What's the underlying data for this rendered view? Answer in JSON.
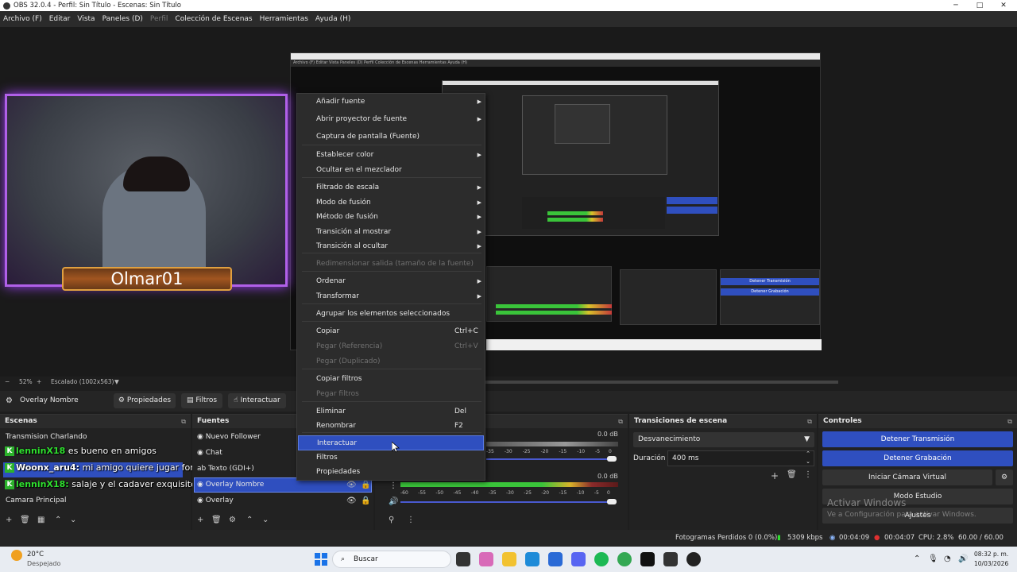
{
  "window": {
    "title": "OBS 32.0.4 - Perfil: Sin Título - Escenas: Sin Título",
    "minimize": "─",
    "maximize": "□",
    "close": "✕"
  },
  "menubar": [
    {
      "label": "Archivo (F)",
      "enabled": true
    },
    {
      "label": "Editar",
      "enabled": true
    },
    {
      "label": "Vista",
      "enabled": true
    },
    {
      "label": "Paneles (D)",
      "enabled": true
    },
    {
      "label": "Perfil",
      "enabled": false
    },
    {
      "label": "Colección de Escenas",
      "enabled": true
    },
    {
      "label": "Herramientas",
      "enabled": true
    },
    {
      "label": "Ayuda (H)",
      "enabled": true
    }
  ],
  "preview": {
    "camera_overlay_name": "Olmar01",
    "zoom": "52%",
    "scaling": "Escalado (1002x563)"
  },
  "context_menu": {
    "items": [
      {
        "label": "Añadir fuente",
        "submenu": true
      },
      {
        "label": "Abrir proyector de fuente",
        "submenu": true
      },
      {
        "label": "Captura de pantalla (Fuente)"
      },
      {
        "label": "Establecer color",
        "submenu": true
      },
      {
        "label": "Ocultar en el mezclador"
      },
      {
        "label": "Filtrado de escala",
        "submenu": true
      },
      {
        "label": "Modo de fusión",
        "submenu": true
      },
      {
        "label": "Método de fusión",
        "submenu": true
      },
      {
        "label": "Transición al mostrar",
        "submenu": true
      },
      {
        "label": "Transición al ocultar",
        "submenu": true
      },
      {
        "label": "Redimensionar salida (tamaño de la fuente)",
        "disabled": true
      },
      {
        "label": "Ordenar",
        "submenu": true
      },
      {
        "label": "Transformar",
        "submenu": true
      },
      {
        "label": "Agrupar los elementos seleccionados"
      },
      {
        "label": "Copiar",
        "shortcut": "Ctrl+C"
      },
      {
        "label": "Pegar (Referencia)",
        "shortcut": "Ctrl+V",
        "disabled": true
      },
      {
        "label": "Pegar (Duplicado)",
        "disabled": true
      },
      {
        "label": "Copiar filtros"
      },
      {
        "label": "Pegar filtros",
        "disabled": true
      },
      {
        "label": "Eliminar",
        "shortcut": "Del"
      },
      {
        "label": "Renombrar",
        "shortcut": "F2"
      },
      {
        "label": "Interactuar",
        "highlighted": true
      },
      {
        "label": "Filtros"
      },
      {
        "label": "Propiedades"
      }
    ]
  },
  "source_toolbar": {
    "selected_source": "Overlay Nombre",
    "properties": "Propiedades",
    "filters": "Filtros",
    "interact": "Interactuar"
  },
  "scenes": {
    "title": "Escenas",
    "items": [
      "Transmision Charlando",
      "Camara Principal"
    ],
    "chat": [
      {
        "user": "lenninX18",
        "msg": "es bueno en amigos"
      },
      {
        "user": "Woonx_aru4:",
        "msg": "mi amigo quiere jugar fornai"
      },
      {
        "user": "lenninX18:",
        "msg": "salaje y el cadaver exquisito tb es bueno"
      }
    ]
  },
  "sources": {
    "title": "Fuentes",
    "items": [
      "Nuevo Follower",
      "Chat",
      "Texto (GDI+)",
      "Overlay Nombre",
      "Overlay"
    ]
  },
  "mixer": {
    "db_top": "0.0 dB",
    "db_bottom": "0.0 dB",
    "ticks": [
      "-35",
      "-30",
      "-25",
      "-20",
      "-15",
      "-10",
      "-5",
      "0"
    ],
    "ticks_full": [
      "-60",
      "-55",
      "-50",
      "-45",
      "-40",
      "-35",
      "-30",
      "-25",
      "-20",
      "-15",
      "-10",
      "-5",
      "0"
    ]
  },
  "transitions": {
    "title": "Transiciones de escena",
    "type": "Desvanecimiento",
    "duration_label": "Duración",
    "duration": "400 ms"
  },
  "controls": {
    "title": "Controles",
    "stop_stream": "Detener Transmisión",
    "stop_record": "Detener Grabación",
    "virtual_cam": "Iniciar Cámara Virtual",
    "studio_mode": "Modo Estudio",
    "settings": "Ajustes",
    "watermark_title": "Activar Windows",
    "watermark_sub": "Ve a Configuración para activar Windows."
  },
  "status": {
    "dropped": "Fotogramas Perdidos 0 (0.0%)",
    "bitrate": "5309 kbps",
    "stream_time": "00:04:09",
    "rec_time": "00:04:07",
    "cpu": "CPU: 2.8%",
    "fps": "60.00 / 60.00 FPS"
  },
  "taskbar": {
    "weather_temp": "20°C",
    "weather_text": "Despejado",
    "search": "Buscar",
    "time": "08:32 p. m.",
    "date": "10/03/2026"
  },
  "colors": {
    "accent": "#2f4fbf",
    "panel": "#222222",
    "menu": "#2c2c2c",
    "chat_user": "#2fe02f",
    "overlay_glow": "#b060e8"
  }
}
